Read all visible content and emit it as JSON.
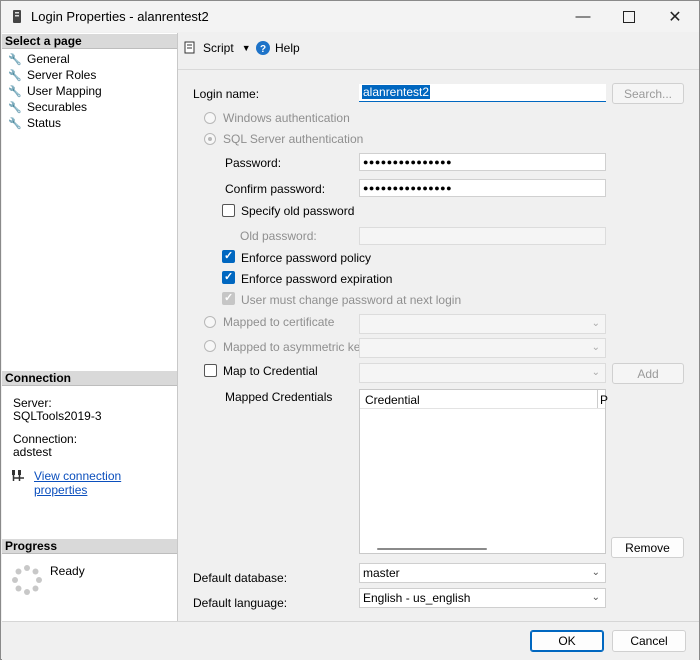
{
  "window": {
    "title": "Login Properties - alanrentest2"
  },
  "left_pane": {
    "select_page_header": "Select a page",
    "pages": [
      {
        "label": "General"
      },
      {
        "label": "Server Roles"
      },
      {
        "label": "User Mapping"
      },
      {
        "label": "Securables"
      },
      {
        "label": "Status"
      }
    ],
    "connection_header": "Connection",
    "server_label": "Server:",
    "server_value": "SQLTools2019-3",
    "connection_label": "Connection:",
    "connection_value": "adstest",
    "view_connection_link": "View connection properties",
    "progress_header": "Progress",
    "progress_status": "Ready"
  },
  "toolbar": {
    "script_label": "Script",
    "help_label": "Help"
  },
  "general": {
    "login_name_label": "Login name:",
    "login_name_value": "alanrentest2",
    "search_button": "Search...",
    "windows_auth": "Windows authentication",
    "sql_auth": "SQL Server authentication",
    "password_label": "Password:",
    "password_value": "●●●●●●●●●●●●●●●",
    "confirm_password_label": "Confirm password:",
    "confirm_password_value": "●●●●●●●●●●●●●●●",
    "specify_old_password": "Specify old password",
    "old_password_label": "Old password:",
    "enforce_policy": "Enforce password policy",
    "enforce_expiration": "Enforce password expiration",
    "must_change": "User must change password at next login",
    "mapped_certificate": "Mapped to certificate",
    "mapped_asymmetric_key": "Mapped to asymmetric key",
    "map_credential": "Map to Credential",
    "add_button": "Add",
    "mapped_credentials_label": "Mapped Credentials",
    "credential_column": "Credential",
    "provider_column_partial": "P",
    "remove_button": "Remove",
    "default_database_label": "Default database:",
    "default_database_value": "master",
    "default_language_label": "Default language:",
    "default_language_value": "English - us_english"
  },
  "footer": {
    "ok_button": "OK",
    "cancel_button": "Cancel"
  },
  "colors": {
    "accent": "#0067c0",
    "link": "#0b4fbd"
  }
}
